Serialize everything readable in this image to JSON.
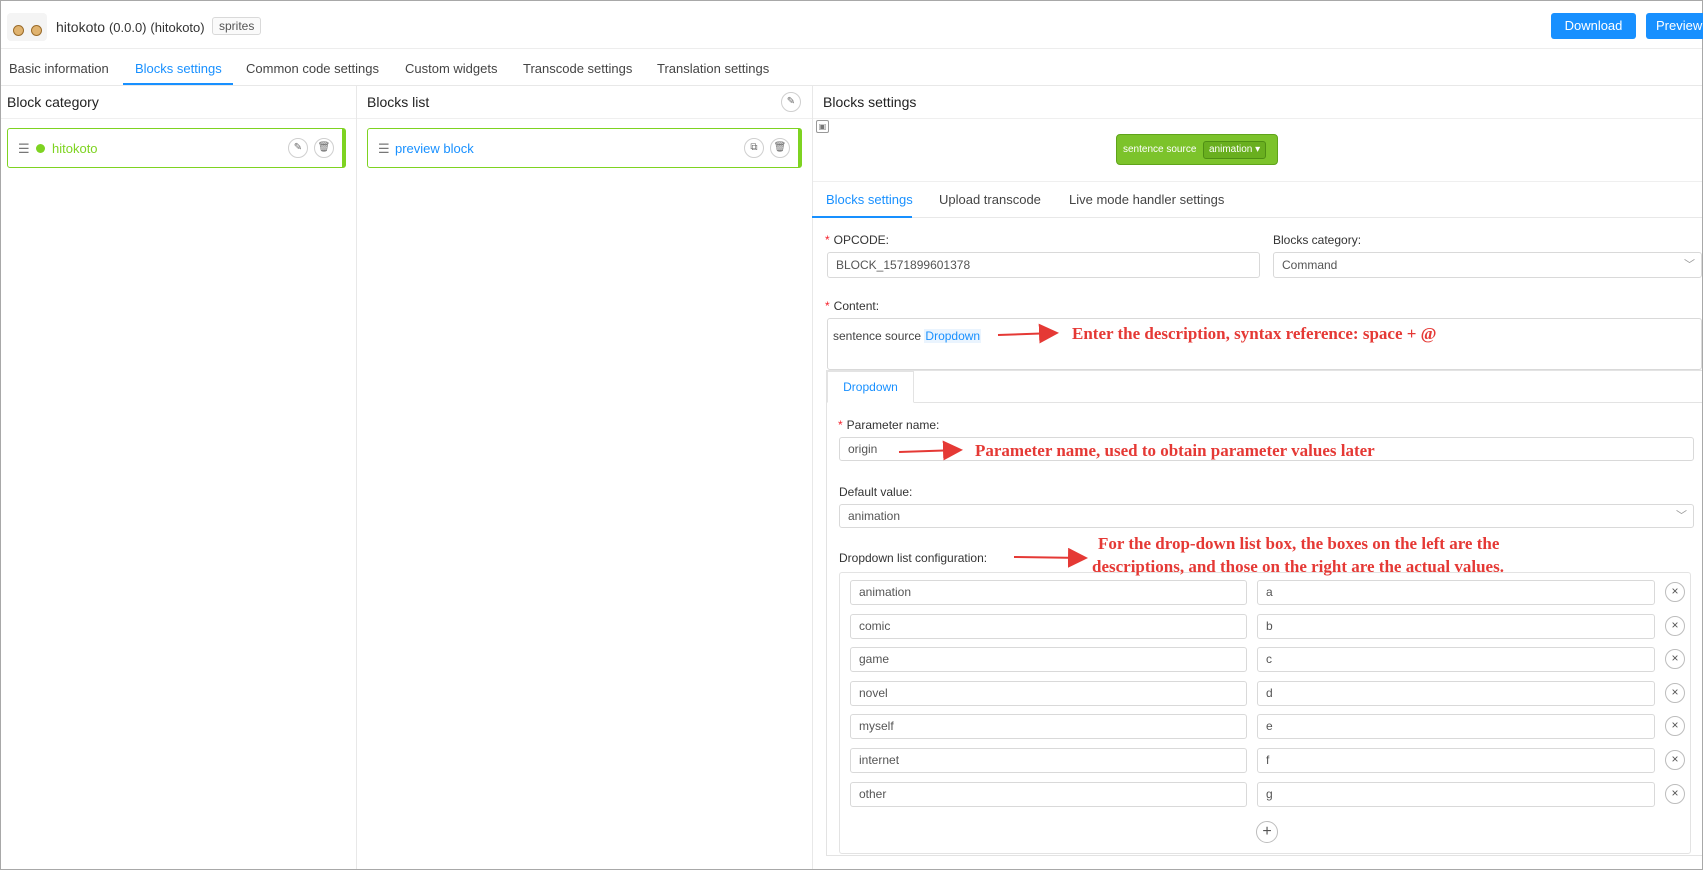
{
  "header": {
    "app_name": "hitokoto",
    "version": "(0.0.0)",
    "id": "(hitokoto)",
    "tag": "sprites",
    "download_label": "Download",
    "preview_label": "Preview"
  },
  "main_tabs": [
    "Basic information",
    "Blocks settings",
    "Common code settings",
    "Custom widgets",
    "Transcode settings",
    "Translation settings"
  ],
  "block_category": {
    "title": "Block category",
    "items": [
      {
        "label": "hitokoto",
        "dot_color": "#7ed321"
      }
    ]
  },
  "blocks_list": {
    "title": "Blocks list",
    "items": [
      {
        "label": "preview block"
      }
    ]
  },
  "blocks_settings": {
    "title": "Blocks settings",
    "preview_block": {
      "text": "sentence source",
      "dropdown": "animation"
    },
    "sub_tabs": [
      "Blocks settings",
      "Upload transcode",
      "Live mode handler settings"
    ],
    "opcode_label": "OPCODE:",
    "opcode_value": "BLOCK_1571899601378",
    "category_label": "Blocks category:",
    "category_value": "Command",
    "content_label": "Content:",
    "content_text": "sentence source",
    "content_highlight": "Dropdown",
    "param_tab": "Dropdown",
    "param_name_label": "Parameter name:",
    "param_name_value": "origin",
    "default_label": "Default value:",
    "default_value": "animation",
    "dropdown_config_label": "Dropdown list configuration:",
    "options": [
      {
        "desc": "animation",
        "value": "a"
      },
      {
        "desc": "comic",
        "value": "b"
      },
      {
        "desc": "game",
        "value": "c"
      },
      {
        "desc": "novel",
        "value": "d"
      },
      {
        "desc": "myself",
        "value": "e"
      },
      {
        "desc": "internet",
        "value": "f"
      },
      {
        "desc": "other",
        "value": "g"
      }
    ]
  },
  "annotations": {
    "content": "Enter the description, syntax reference: space + @",
    "param": "Parameter name, used to obtain parameter values  later",
    "dropdown_line1": "For the drop-down list box, the boxes on the left are the",
    "dropdown_line2": "descriptions, and those on the right are the actual values."
  },
  "colors": {
    "accent": "#1890ff",
    "block_green": "#7ed321",
    "annotation_red": "#e53935"
  }
}
